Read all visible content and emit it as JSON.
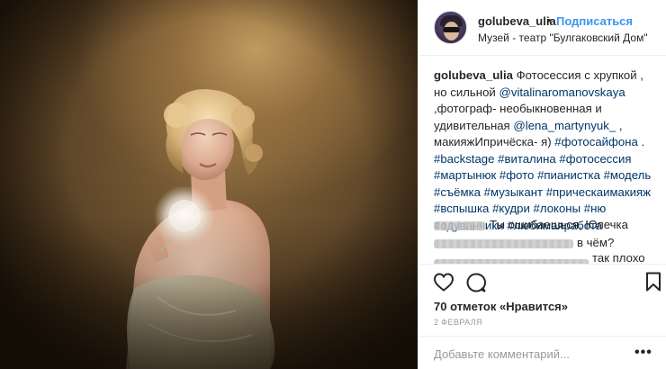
{
  "post": {
    "author": {
      "username": "golubeva_ulia",
      "follow_label": "Подписаться",
      "separator": "•",
      "location": "Музей - театр \"Булгаковский Дом\""
    },
    "caption": {
      "username": "golubeva_ulia",
      "text_1": " Фотосессия с хрупкой , но сильной ",
      "mention_1": "@vitalinaromanovskaya",
      "text_2": " ,фотограф- необыкновенная и удивительная ",
      "mention_2": "@lena_martynyuk_",
      "text_3": " , макияжИпричёска- я) ",
      "hashtags": [
        "#фотосайфона",
        "#backstage",
        "#виталина",
        "#фотосессия",
        "#мартынюк",
        "#фото",
        "#пианистка",
        "#модель",
        "#съёмка",
        "#музыкант",
        "#прическаимакияж",
        "#вспышка",
        "#кудри",
        "#локоны",
        "#ню",
        "#одуванчики",
        "#любимаяработа"
      ],
      "text_4": " ."
    },
    "comments": [
      {
        "text": "Ты ошибаешься, Юлечка"
      },
      {
        "text": "в чём?"
      },
      {
        "text": "так плохо"
      }
    ],
    "likes_label": "70 отметок «Нравится»",
    "date_label": "2 ФЕВРАЛЯ",
    "comment_placeholder": "Добавьте комментарий...",
    "more_label": "•••"
  },
  "icons": {
    "like": "heart-icon",
    "comment": "comment-bubble-icon",
    "save": "bookmark-icon",
    "more": "more-dots-icon"
  },
  "colors": {
    "link": "#3897f0",
    "hashtag": "#003569",
    "text": "#262626",
    "muted": "#999999",
    "border": "#efefef"
  }
}
